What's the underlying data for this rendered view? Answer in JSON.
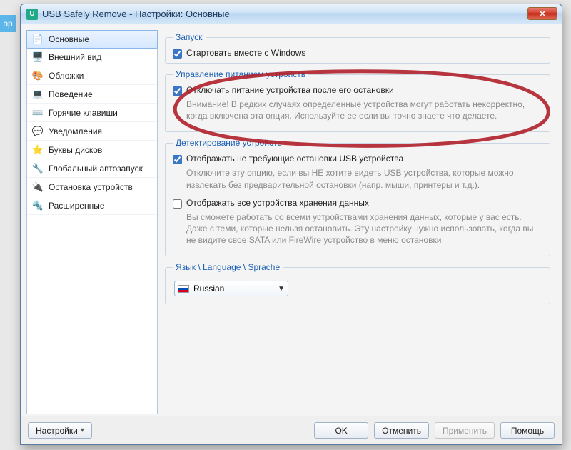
{
  "window": {
    "title": "USB Safely Remove - Настройки: Основные"
  },
  "sidebar": {
    "items": [
      {
        "label": "Основные",
        "icon": "📄",
        "selected": true
      },
      {
        "label": "Внешний вид",
        "icon": "🖥️",
        "selected": false
      },
      {
        "label": "Обложки",
        "icon": "🎨",
        "selected": false
      },
      {
        "label": "Поведение",
        "icon": "💻",
        "selected": false
      },
      {
        "label": "Горячие клавиши",
        "icon": "⌨️",
        "selected": false
      },
      {
        "label": "Уведомления",
        "icon": "💬",
        "selected": false
      },
      {
        "label": "Буквы дисков",
        "icon": "⭐",
        "selected": false
      },
      {
        "label": "Глобальный автозапуск",
        "icon": "🔧",
        "selected": false
      },
      {
        "label": "Остановка устройств",
        "icon": "🔌",
        "selected": false
      },
      {
        "label": "Расширенные",
        "icon": "🔩",
        "selected": false
      }
    ]
  },
  "groups": {
    "startup": {
      "legend": "Запуск",
      "c1": {
        "label": "Стартовать вместе с Windows",
        "checked": true
      }
    },
    "power": {
      "legend": "Управление питанием устройств",
      "c1": {
        "label": "Отключать питание устройства после его остановки",
        "checked": true
      },
      "desc": "Внимание! В редких случаях определенные устройства могут работать некорректно, когда включена эта опция. Используйте ее если вы точно знаете что делаете."
    },
    "detect": {
      "legend": "Детектирование устройств",
      "c1": {
        "label": "Отображать не требующие остановки USB устройства",
        "checked": true
      },
      "d1": "Отключите эту опцию, если вы НЕ хотите видеть USB устройства, которые можно извлекать без предварительной остановки (напр. мыши, принтеры и т.д.).",
      "c2": {
        "label": "Отображать все устройства хранения данных",
        "checked": false
      },
      "d2": "Вы сможете работать со всеми устройствами хранения данных, которые у вас есть. Даже с теми, которые нельзя остановить. Эту настройку нужно использовать, когда вы не видите свое SATA или FireWire устройство в меню остановки"
    },
    "lang": {
      "legend": "Язык \\ Language \\ Sprache",
      "value": "Russian"
    }
  },
  "buttons": {
    "settings": "Настройки",
    "ok": "OK",
    "cancel": "Отменить",
    "apply": "Применить",
    "help": "Помощь"
  },
  "page_bg": {
    "tab": "ор"
  }
}
